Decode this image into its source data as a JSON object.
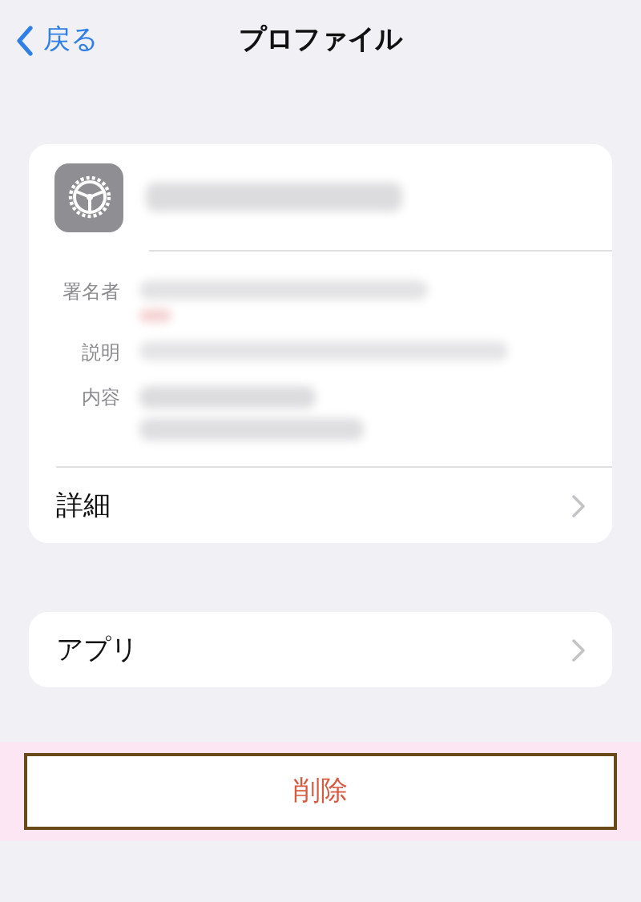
{
  "nav": {
    "back": "戻る",
    "title": "プロファイル"
  },
  "fields": [
    {
      "label": "署名者"
    },
    {
      "label": "説明"
    },
    {
      "label": "内容"
    }
  ],
  "rows": [
    {
      "label": "詳細"
    }
  ],
  "apps": {
    "label": "アプリ"
  },
  "delete": {
    "label": "削除",
    "highlighted": true
  }
}
